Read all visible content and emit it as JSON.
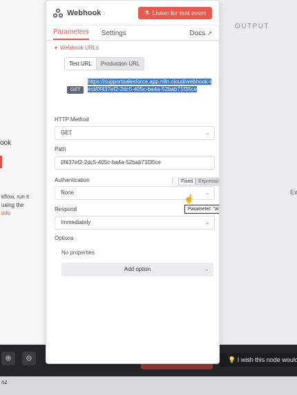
{
  "background": {
    "node_title": "ook",
    "hint_line1": "kflow, run it",
    "hint_line2": "using the",
    "hint_link": "info",
    "output_label": "OUTPUT",
    "ex_label": "Ex",
    "feedback": "I wish this node would..."
  },
  "below_bar_text": "nz",
  "panel": {
    "title": "Webhook",
    "listen_button": "Listen for test event",
    "tabs": [
      {
        "label": "Parameters"
      },
      {
        "label": "Settings"
      },
      {
        "label": "Docs"
      }
    ],
    "webhook_urls_label": "Webhook URLs",
    "url_tabs": [
      "Test URL",
      "Production URL"
    ],
    "method_badge": "GET",
    "url": "https://supportsalesforce.app.n8n.cloud/webhook-test/0f437ef2-2dc5-405c-ba4a-52bab71f35ce",
    "http_method_label": "HTTP Method",
    "http_method_value": "GET",
    "path_label": "Path",
    "path_value": "0f437ef2-2dc5-405c-ba4a-52bab71f35ce",
    "authentication_label": "Authentication",
    "fixed_label": "Fixed",
    "expression_label": "Expression",
    "authentication_value": "None",
    "tooltip": "Parameter: \"authentication\"",
    "respond_label": "Respond",
    "respond_value": "Immediately",
    "options_label": "Options",
    "no_properties": "No properties",
    "add_option": "Add option"
  },
  "colors": {
    "accent": "#e85a4f",
    "selection": "#3a76c9"
  }
}
